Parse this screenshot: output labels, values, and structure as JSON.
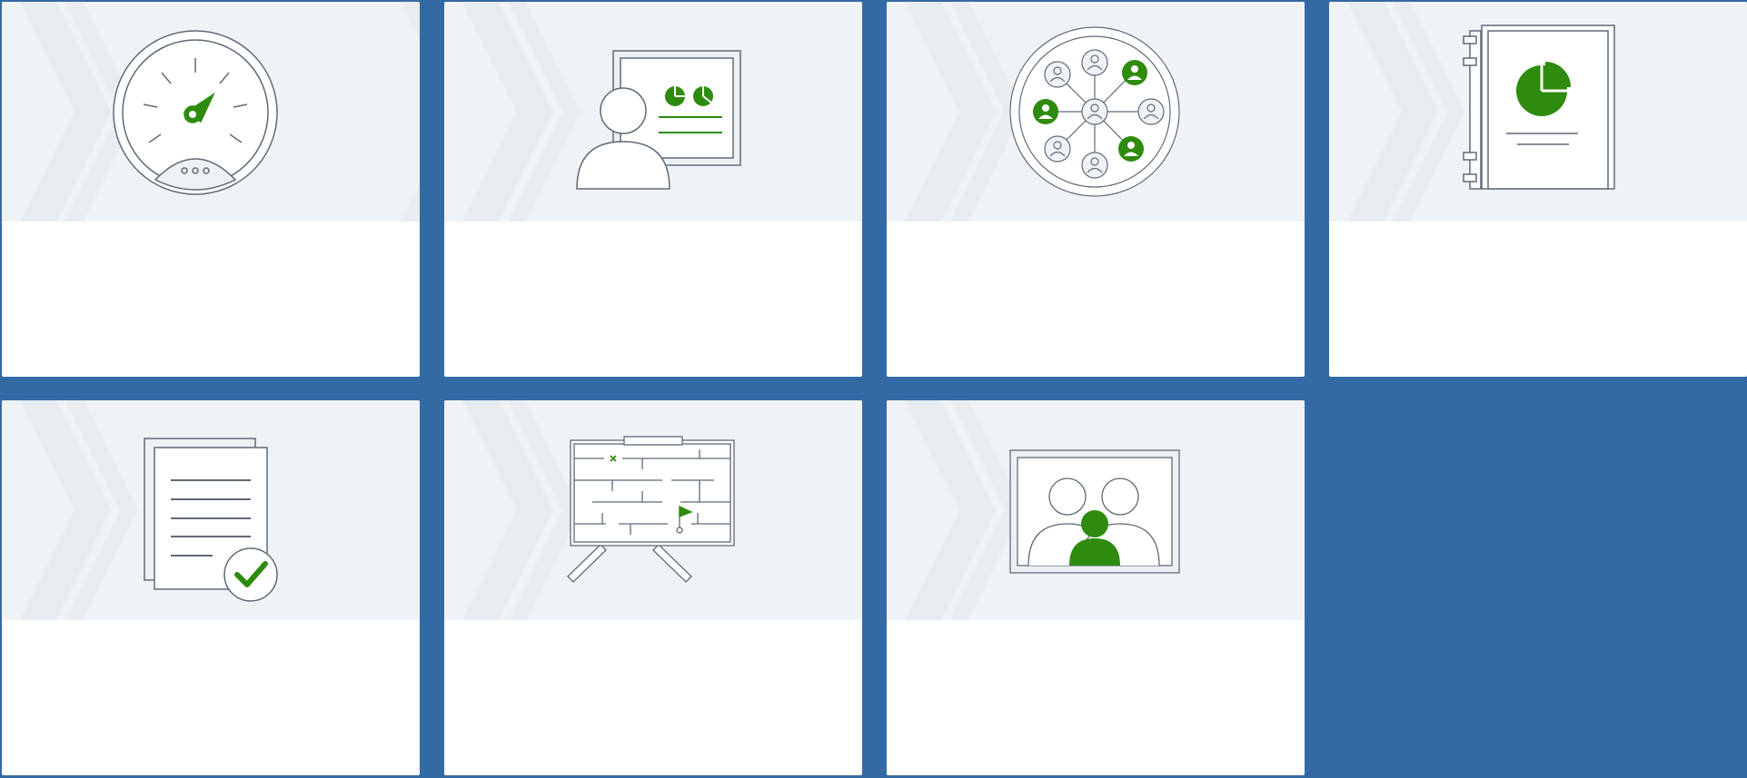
{
  "colors": {
    "background": "#346aa3",
    "card": "#ffffff",
    "banner": "#f0f3f6",
    "stroke": "#5e6a78",
    "accent": "#2e8b0e"
  },
  "cards": [
    {
      "icon": "speedometer-icon"
    },
    {
      "icon": "presenter-icon"
    },
    {
      "icon": "people-network-icon"
    },
    {
      "icon": "pie-chart-binder-icon"
    },
    {
      "icon": "document-checkmark-icon"
    },
    {
      "icon": "maze-easel-icon"
    },
    {
      "icon": "video-meeting-icon"
    }
  ]
}
